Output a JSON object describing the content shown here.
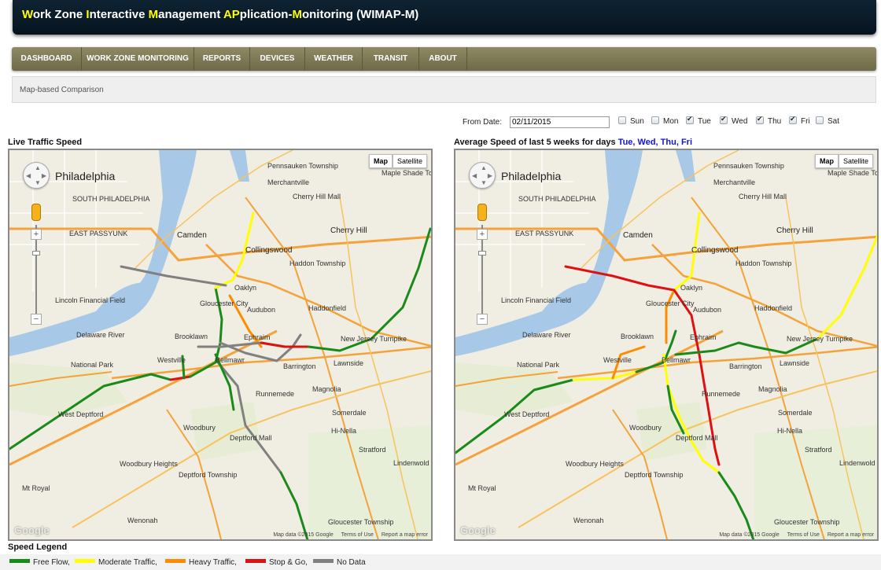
{
  "header": {
    "title_parts": [
      {
        "text": "W",
        "hl": true
      },
      {
        "text": "ork Zone ",
        "hl": false
      },
      {
        "text": "I",
        "hl": true
      },
      {
        "text": "nteractive ",
        "hl": false
      },
      {
        "text": "M",
        "hl": true
      },
      {
        "text": "anagement ",
        "hl": false
      },
      {
        "text": "AP",
        "hl": true
      },
      {
        "text": "plication-",
        "hl": false
      },
      {
        "text": "M",
        "hl": true
      },
      {
        "text": "onitoring (WIMAP-M)",
        "hl": false
      }
    ]
  },
  "nav": {
    "items": [
      {
        "label": "DASHBOARD"
      },
      {
        "label": "WORK ZONE MONITORING"
      },
      {
        "label": "REPORTS"
      },
      {
        "label": "DEVICES"
      },
      {
        "label": "WEATHER"
      },
      {
        "label": "TRANSIT"
      },
      {
        "label": "ABOUT"
      }
    ]
  },
  "breadcrumb": "Map-based Comparison",
  "filters": {
    "from_date_label": "From Date:",
    "from_date_value": "02/11/2015",
    "days": [
      {
        "label": "Sun",
        "checked": false
      },
      {
        "label": "Mon",
        "checked": false
      },
      {
        "label": "Tue",
        "checked": true
      },
      {
        "label": "Wed",
        "checked": true
      },
      {
        "label": "Thu",
        "checked": true
      },
      {
        "label": "Fri",
        "checked": true
      },
      {
        "label": "Sat",
        "checked": false
      }
    ]
  },
  "left_panel": {
    "title": "Live Traffic Speed"
  },
  "right_panel": {
    "title_prefix": "Average Speed of last 5 weeks for days ",
    "title_days": "Tue, Wed, Thu, Fri"
  },
  "map": {
    "map_button": "Map",
    "satellite_button": "Satellite",
    "zoom_in": "+",
    "zoom_out": "−",
    "footer": {
      "data": "Map data ©2015 Google",
      "terms": "Terms of Use",
      "report": "Report a map error"
    },
    "logo": "Google",
    "labels": [
      {
        "t": "Philadelphia",
        "c": "big"
      },
      {
        "t": "Camden",
        "c": "med"
      },
      {
        "t": "Cherry Hill",
        "c": "med"
      },
      {
        "t": "Collingswood",
        "c": "med"
      },
      {
        "t": "Pennsauken Township",
        "c": ""
      },
      {
        "t": "Merchantville",
        "c": ""
      },
      {
        "t": "Maple Shade Township",
        "c": ""
      },
      {
        "t": "Haddon Township",
        "c": ""
      },
      {
        "t": "Oaklyn",
        "c": ""
      },
      {
        "t": "Audubon",
        "c": ""
      },
      {
        "t": "Haddonfield",
        "c": ""
      },
      {
        "t": "Gloucester City",
        "c": ""
      },
      {
        "t": "Brooklawn",
        "c": ""
      },
      {
        "t": "Ephraim",
        "c": ""
      },
      {
        "t": "Bellmawr",
        "c": ""
      },
      {
        "t": "Westville",
        "c": ""
      },
      {
        "t": "National Park",
        "c": ""
      },
      {
        "t": "Barrington",
        "c": ""
      },
      {
        "t": "Lawnside",
        "c": ""
      },
      {
        "t": "Runnemede",
        "c": ""
      },
      {
        "t": "Magnolia",
        "c": ""
      },
      {
        "t": "Somerdale",
        "c": ""
      },
      {
        "t": "Hi-Nella",
        "c": ""
      },
      {
        "t": "Stratford",
        "c": ""
      },
      {
        "t": "West Deptford",
        "c": ""
      },
      {
        "t": "Woodbury",
        "c": ""
      },
      {
        "t": "Deptford Mall",
        "c": ""
      },
      {
        "t": "Woodbury Heights",
        "c": ""
      },
      {
        "t": "Deptford Township",
        "c": ""
      },
      {
        "t": "Mt Royal",
        "c": ""
      },
      {
        "t": "Wenonah",
        "c": ""
      },
      {
        "t": "Gloucester Township",
        "c": ""
      },
      {
        "t": "Lincoln Financial Field",
        "c": ""
      },
      {
        "t": "Lindenwold",
        "c": ""
      },
      {
        "t": "Cherry Hill Mall",
        "c": ""
      },
      {
        "t": "Delaware River",
        "c": ""
      },
      {
        "t": "SOUTH PHILADELPHIA",
        "c": ""
      },
      {
        "t": "EAST PASSYUNK",
        "c": ""
      },
      {
        "t": "New Jersey Turnpike",
        "c": ""
      }
    ]
  },
  "legend": {
    "title": "Speed Legend",
    "items": [
      {
        "label": "Free Flow,",
        "color": "#1a8a1a"
      },
      {
        "label": "Moderate Traffic,",
        "color": "#ffff00"
      },
      {
        "label": "Heavy Traffic,",
        "color": "#ff8c00"
      },
      {
        "label": "Stop & Go,",
        "color": "#dd1111"
      },
      {
        "label": "No Data",
        "color": "#808080"
      }
    ]
  }
}
